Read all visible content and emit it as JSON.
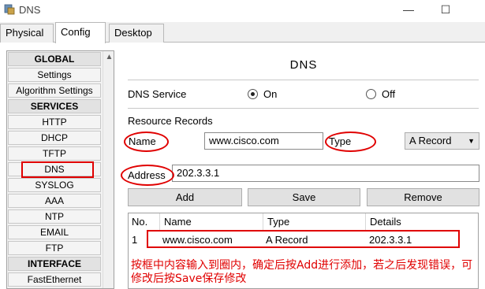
{
  "window": {
    "title": "DNS",
    "minimize": "—",
    "maximize": "☐"
  },
  "tabs": [
    {
      "label": "Physical",
      "active": false
    },
    {
      "label": "Config",
      "active": true
    },
    {
      "label": "Desktop",
      "active": false
    }
  ],
  "sidebar": {
    "items": [
      {
        "label": "GLOBAL",
        "header": true
      },
      {
        "label": "Settings"
      },
      {
        "label": "Algorithm Settings"
      },
      {
        "label": "SERVICES",
        "header": true
      },
      {
        "label": "HTTP"
      },
      {
        "label": "DHCP"
      },
      {
        "label": "TFTP"
      },
      {
        "label": "DNS",
        "selected": true
      },
      {
        "label": "SYSLOG"
      },
      {
        "label": "AAA"
      },
      {
        "label": "NTP"
      },
      {
        "label": "EMAIL"
      },
      {
        "label": "FTP"
      },
      {
        "label": "INTERFACE",
        "header": true
      },
      {
        "label": "FastEthernet"
      }
    ],
    "scroll_up": "▲"
  },
  "dns": {
    "title": "DNS",
    "service_label": "DNS Service",
    "on_label": "On",
    "off_label": "Off",
    "service_on": true,
    "resource_records_label": "Resource Records",
    "name_label": "Name",
    "name_value": "www.cisco.com",
    "type_label": "Type",
    "type_value": "A Record",
    "address_label": "Address",
    "address_value": "202.3.3.1",
    "add_label": "Add",
    "save_label": "Save",
    "remove_label": "Remove"
  },
  "table": {
    "headers": [
      "No.",
      "Name",
      "Type",
      "Details"
    ],
    "rows": [
      {
        "no": "1",
        "name": "www.cisco.com",
        "type": "A Record",
        "details": "202.3.3.1"
      }
    ]
  },
  "annotation": "按框中内容输入到圈内，确定后按Add进行添加，若之后发现错误，可修改后按Save保存修改",
  "colors": {
    "highlight": "#e00000",
    "panel": "#f0f0f0"
  }
}
